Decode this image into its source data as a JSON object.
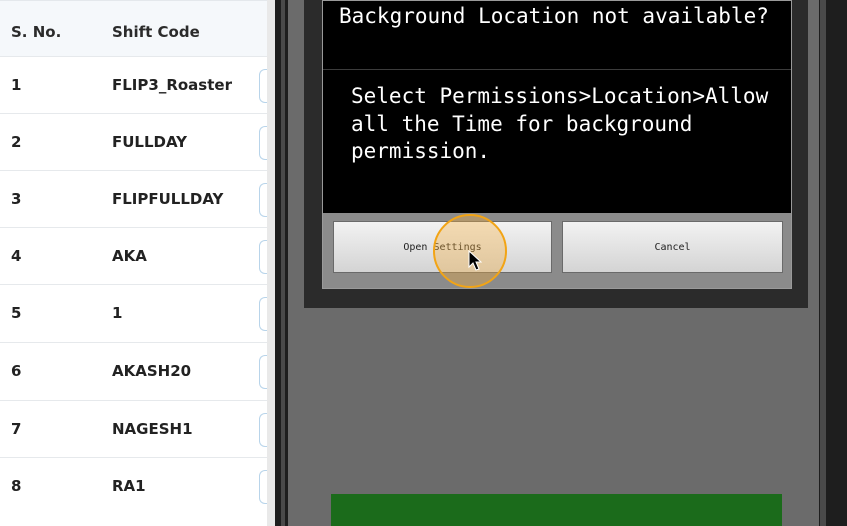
{
  "table": {
    "headers": {
      "sno": "S. No.",
      "shift_code": "Shift Code"
    },
    "rows": [
      {
        "sno": "1",
        "code": "FLIP3_Roaster"
      },
      {
        "sno": "2",
        "code": "FULLDAY"
      },
      {
        "sno": "3",
        "code": "FLIPFULLDAY"
      },
      {
        "sno": "4",
        "code": "AKA"
      },
      {
        "sno": "5",
        "code": "1"
      },
      {
        "sno": "6",
        "code": "AKASH20"
      },
      {
        "sno": "7",
        "code": "NAGESH1"
      },
      {
        "sno": "8",
        "code": "RA1"
      }
    ]
  },
  "dialog": {
    "title": "Background Location not available?",
    "message": "Select Permissions>Location>Allow all the Time for background permission.",
    "open_settings_label": "Open Settings",
    "cancel_label": "Cancel"
  },
  "colors": {
    "accent": "#f2a415",
    "dialog_bg": "#000000",
    "green_bar": "#1b6b1b"
  }
}
